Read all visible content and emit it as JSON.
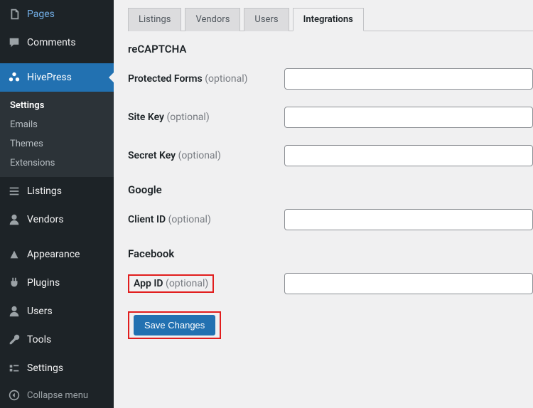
{
  "sidebar": {
    "pages": "Pages",
    "comments": "Comments",
    "hivepress": "HivePress",
    "sub": {
      "settings": "Settings",
      "emails": "Emails",
      "themes": "Themes",
      "extensions": "Extensions"
    },
    "listings": "Listings",
    "vendors": "Vendors",
    "appearance": "Appearance",
    "plugins": "Plugins",
    "users": "Users",
    "tools": "Tools",
    "settings": "Settings",
    "collapse": "Collapse menu"
  },
  "tabs": {
    "listings": "Listings",
    "vendors": "Vendors",
    "users": "Users",
    "integrations": "Integrations"
  },
  "sections": {
    "recaptcha": "reCAPTCHA",
    "google": "Google",
    "facebook": "Facebook"
  },
  "fields": {
    "protected_forms": {
      "label": "Protected Forms",
      "optional": " (optional)"
    },
    "site_key": {
      "label": "Site Key",
      "optional": " (optional)",
      "value": ""
    },
    "secret_key": {
      "label": "Secret Key",
      "optional": " (optional)",
      "value": ""
    },
    "client_id": {
      "label": "Client ID",
      "optional": " (optional)",
      "value": ""
    },
    "app_id": {
      "label": "App ID",
      "optional": " (optional)",
      "value": ""
    }
  },
  "save_button": "Save Changes"
}
